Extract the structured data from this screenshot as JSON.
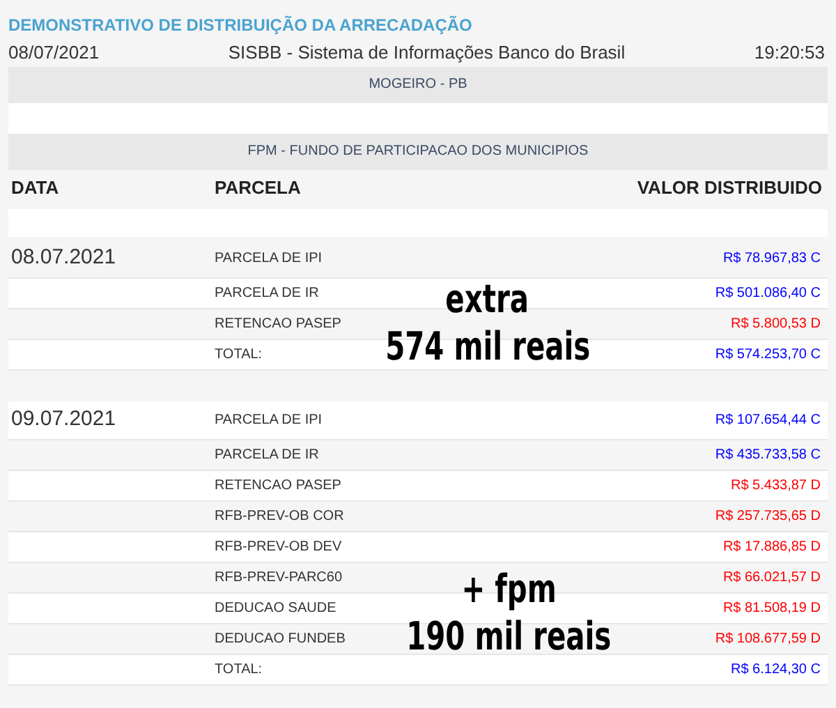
{
  "report_title": "DEMONSTRATIVO DE DISTRIBUIÇÃO DA ARRECADAÇÃO",
  "header": {
    "date": "08/07/2021",
    "system": "SISBB - Sistema de Informações Banco do Brasil",
    "time": "19:20:53"
  },
  "municipality": "MOGEIRO - PB",
  "fund": "FPM - FUNDO DE PARTICIPACAO DOS MUNICIPIOS",
  "columns": [
    "DATA",
    "PARCELA",
    "VALOR DISTRIBUIDO"
  ],
  "groups": [
    {
      "date": "08.07.2021",
      "rows": [
        {
          "parcela": "PARCELA DE IPI",
          "valor": "R$ 78.967,83 C",
          "color": "#0000ff"
        },
        {
          "parcela": "PARCELA DE IR",
          "valor": "R$ 501.086,40 C",
          "color": "#0000ff"
        },
        {
          "parcela": "RETENCAO PASEP",
          "valor": "R$ 5.800,53 D",
          "color": "#ff0000"
        },
        {
          "parcela": "TOTAL:",
          "valor": "R$ 574.253,70 C",
          "color": "#0000ff"
        }
      ]
    },
    {
      "date": "09.07.2021",
      "rows": [
        {
          "parcela": "PARCELA DE IPI",
          "valor": "R$ 107.654,44 C",
          "color": "#0000ff"
        },
        {
          "parcela": "PARCELA DE IR",
          "valor": "R$ 435.733,58 C",
          "color": "#0000ff"
        },
        {
          "parcela": "RETENCAO PASEP",
          "valor": "R$ 5.433,87 D",
          "color": "#ff0000"
        },
        {
          "parcela": "RFB-PREV-OB COR",
          "valor": "R$ 257.735,65 D",
          "color": "#ff0000"
        },
        {
          "parcela": "RFB-PREV-OB DEV",
          "valor": "R$ 17.886,85 D",
          "color": "#ff0000"
        },
        {
          "parcela": "RFB-PREV-PARC60",
          "valor": "R$ 66.021,57 D",
          "color": "#ff0000"
        },
        {
          "parcela": "DEDUCAO SAUDE",
          "valor": "R$ 81.508,19 D",
          "color": "#ff0000"
        },
        {
          "parcela": "DEDUCAO FUNDEB",
          "valor": "R$ 108.677,59 D",
          "color": "#ff0000"
        },
        {
          "parcela": "TOTAL:",
          "valor": "R$ 6.124,30 C",
          "color": "#0000ff"
        }
      ]
    }
  ],
  "overlay_notes": [
    {
      "lines": [
        "extra",
        "574 mil reais"
      ]
    },
    {
      "lines": [
        "+ fpm",
        "190 mil reais"
      ]
    }
  ]
}
